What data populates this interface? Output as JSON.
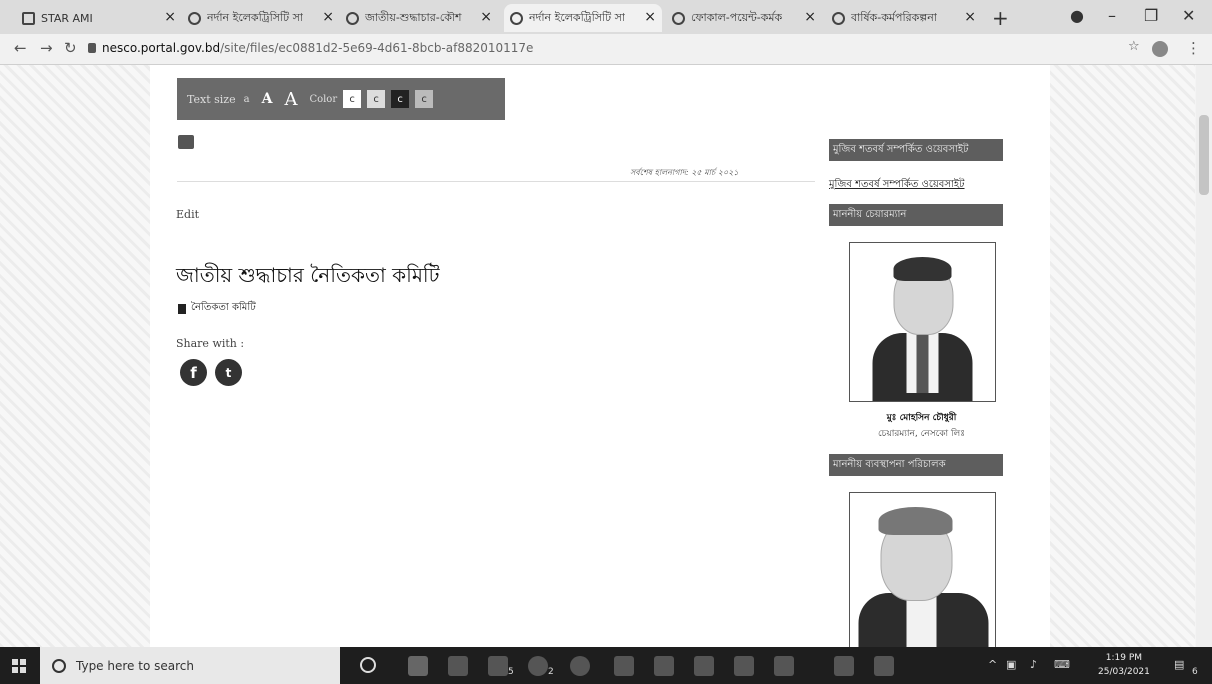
{
  "browser": {
    "tabs": [
      {
        "title": "STAR AMI"
      },
      {
        "title": "নর্দান ইলেকট্রিসিটি সা"
      },
      {
        "title": "জাতীয়-শুদ্ধাচার-কৌশ"
      },
      {
        "title": "নর্দান ইলেকট্রিসিটি সা"
      },
      {
        "title": "ফোকাল-পয়েন্ট-কর্মক"
      },
      {
        "title": "বার্ষিক-কর্মপরিকল্পনা"
      }
    ],
    "new_tab": "+",
    "url_host": "nesco.portal.gov.bd",
    "url_path": "/site/files/ec0881d2-5e69-4d61-8bcb-af882010117e"
  },
  "toolbar": {
    "text_size_label": "Text size",
    "size_small": "a",
    "size_medium": "A",
    "size_large": "A",
    "color_label": "Color",
    "color_buttons": [
      "c",
      "c",
      "c",
      "c"
    ]
  },
  "content": {
    "last_updated": "সর্বশেষ হালনাগাদ: ২৫ মার্চ ২০২১",
    "edit_label": "Edit",
    "page_title": "জাতীয় শুদ্ধাচার নৈতিকতা কমিটি",
    "attachment_label": "নৈতিকতা কমিটি",
    "share_label": "Share with :",
    "facebook_glyph": "f",
    "twitter_glyph": "t"
  },
  "sidebar": {
    "block1_title": "মুজিব শতবর্ষ সম্পর্কিত ওয়েবসাইট",
    "block1_link": "মুজিব শতবর্ষ সম্পর্কিত ওয়েবসাইট",
    "block2_title": "মাননীয় চেয়ারম্যান",
    "chairman_name": "মুঃ মোহসিন চৌধুরী",
    "chairman_role": "চেয়ারম্যান, নেসকো লিঃ",
    "block3_title": "মাননীয় ব্যবস্থাপনা পরিচালক"
  },
  "taskbar": {
    "search_placeholder": "Type here to search",
    "time": "1:19 PM",
    "date": "25/03/2021",
    "mail_badge": "5",
    "chrome_badge": "2",
    "notif_badge": "6"
  }
}
